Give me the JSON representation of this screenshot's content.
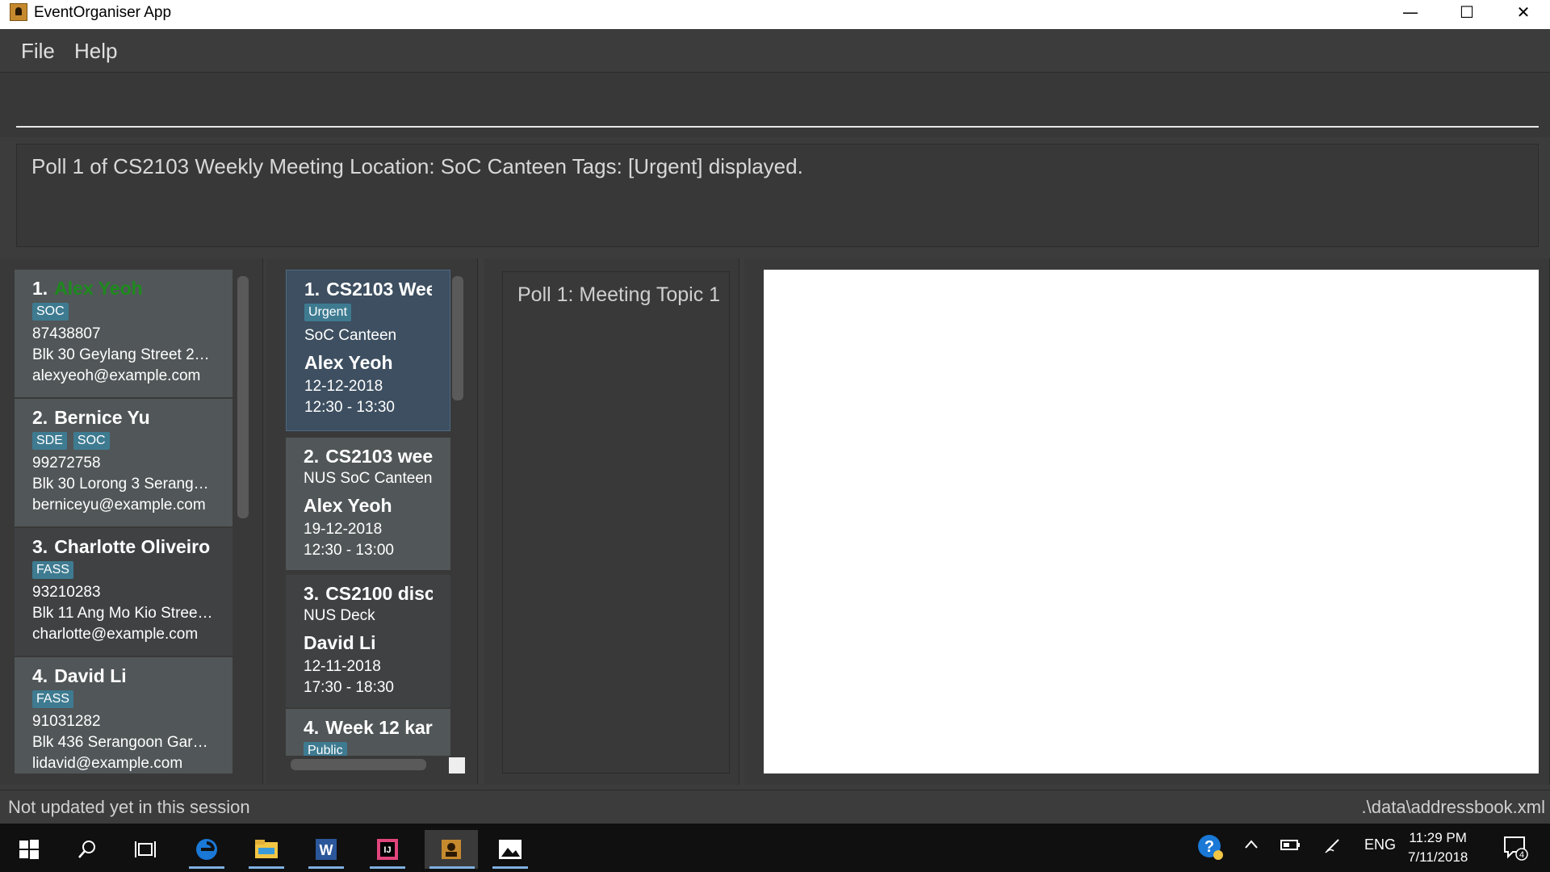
{
  "window": {
    "title": "EventOrganiser App",
    "minimize": "—",
    "maximize": "☐",
    "close": "✕"
  },
  "menu": {
    "file": "File",
    "help": "Help"
  },
  "command": {
    "value": "",
    "placeholder": ""
  },
  "result_display": "Poll 1 of CS2103 Weekly Meeting Location: SoC Canteen Tags: [Urgent] displayed.",
  "persons": [
    {
      "index": "1.",
      "name": "Alex Yeoh",
      "tags": [
        "SOC"
      ],
      "phone": "87438807",
      "address": "Blk 30 Geylang Street 29, ...",
      "email": "alexyeoh@example.com",
      "name_color": "#1d8a1d"
    },
    {
      "index": "2.",
      "name": "Bernice Yu",
      "tags": [
        "SDE",
        "SOC"
      ],
      "phone": "99272758",
      "address": "Blk 30 Lorong 3 Serangoo...",
      "email": "berniceyu@example.com"
    },
    {
      "index": "3.",
      "name": "Charlotte Oliveiro",
      "tags": [
        "FASS"
      ],
      "phone": "93210283",
      "address": "Blk 11 Ang Mo Kio Street ...",
      "email": "charlotte@example.com"
    },
    {
      "index": "4.",
      "name": "David Li",
      "tags": [
        "FASS"
      ],
      "phone": "91031282",
      "address": "Blk 436 Serangoon Garde...",
      "email": "lidavid@example.com"
    }
  ],
  "events": [
    {
      "index": "1.",
      "title": "CS2103 Wee...",
      "tags": [
        "Urgent"
      ],
      "location": "SoC Canteen",
      "organiser": "Alex Yeoh",
      "date": "12-12-2018",
      "time": "12:30 - 13:30"
    },
    {
      "index": "2.",
      "title": "CS2103 week...",
      "tags": [],
      "location": "NUS SoC Canteen",
      "organiser": "Alex Yeoh",
      "date": "19-12-2018",
      "time": "12:30 - 13:00"
    },
    {
      "index": "3.",
      "title": "CS2100 discu...",
      "tags": [],
      "location": "NUS Deck",
      "organiser": "David Li",
      "date": "12-11-2018",
      "time": "17:30 - 18:30"
    },
    {
      "index": "4.",
      "title": "Week 12 kar...",
      "tags": [
        "Public"
      ],
      "location": "",
      "organiser": "",
      "date": "",
      "time": ""
    }
  ],
  "polls": [
    {
      "label": "Poll 1: Meeting Topic 1"
    }
  ],
  "status": {
    "left": "Not updated yet in this session",
    "right": ".\\data\\addressbook.xml"
  },
  "taskbar": {
    "apps": [
      "start-icon",
      "search-icon",
      "task-view-icon",
      "edge-icon",
      "file-explorer-icon",
      "word-icon",
      "intellij-icon",
      "event-organiser-icon",
      "photos-icon"
    ],
    "language": "ENG",
    "time": "11:29 PM",
    "date": "7/11/2018",
    "notifications": "4"
  },
  "colors": {
    "accent_tag": "#3e7b91",
    "selected_card": "#3d4f60",
    "background": "#3c3c3c"
  }
}
